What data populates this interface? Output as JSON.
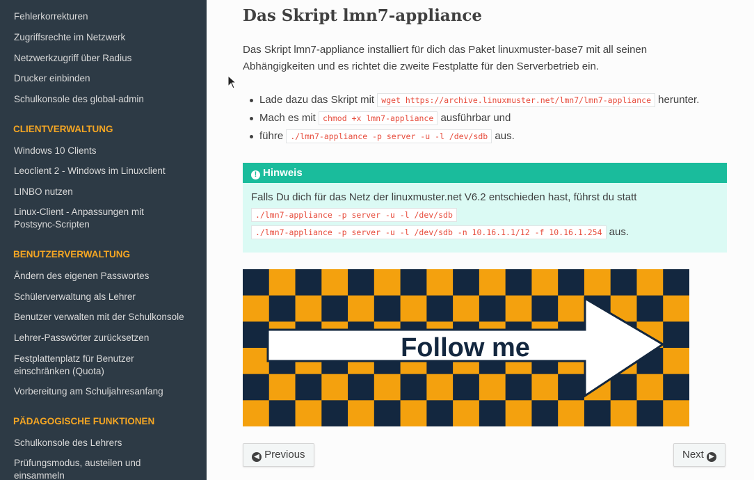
{
  "sidebar": {
    "items_top": [
      "Fehlerkorrekturen",
      "Zugriffsrechte im Netzwerk",
      "Netzwerkzugriff über Radius",
      "Drucker einbinden",
      "Schulkonsole des global-admin"
    ],
    "caption_client": "CLIENTVERWALTUNG",
    "items_client": [
      "Windows 10 Clients",
      "Leoclient 2 - Windows im Linuxclient",
      "LINBO nutzen",
      "Linux-Client - Anpassungen mit Postsync-Scripten"
    ],
    "caption_user": "BENUTZERVERWALTUNG",
    "items_user": [
      "Ändern des eigenen Passwortes",
      "Schülerverwaltung als Lehrer",
      "Benutzer verwalten mit der Schulkonsole",
      "Lehrer-Passwörter zurücksetzen",
      "Festplattenplatz für Benutzer einschränken (Quota)",
      "Vorbereitung am Schuljahresanfang"
    ],
    "caption_paed": "PÄDAGOGISCHE FUNKTIONEN",
    "items_paed": [
      "Schulkonsole des Lehrers",
      "Prüfungsmodus, austeilen und einsammeln"
    ]
  },
  "content": {
    "title": "Das Skript lmn7-appliance",
    "intro": "Das Skript lmn7-appliance installiert für dich das Paket linuxmuster-base7 mit all seinen Abhängigkeiten und es richtet die zweite Festplatte für den Serverbetrieb ein.",
    "steps": [
      {
        "pre": "Lade dazu das Skript mit ",
        "code": "wget https://archive.linuxmuster.net/lmn7/lmn7-appliance",
        "post": " herunter."
      },
      {
        "pre": "Mach es mit ",
        "code": "chmod +x lmn7-appliance",
        "post": " ausführbar und"
      },
      {
        "pre": "führe ",
        "code": "./lmn7-appliance -p server -u -l /dev/sdb",
        "post": " aus."
      }
    ],
    "note": {
      "title": "Hinweis",
      "text": "Falls Du dich für das Netz der linuxmuster.net V6.2 entschieden hast, führst du statt",
      "code1": "./lmn7-appliance -p server -u -l /dev/sdb",
      "code2": "./lmn7-appliance -p server -u -l /dev/sdb -n 10.16.1.1/12 -f 10.16.1.254",
      "post": " aus."
    },
    "image_text": "Follow me",
    "colors": {
      "orange": "#f4a10e",
      "navy": "#13273f",
      "accent": "#1abc9c"
    }
  },
  "nav": {
    "previous": "Previous",
    "next": "Next"
  }
}
